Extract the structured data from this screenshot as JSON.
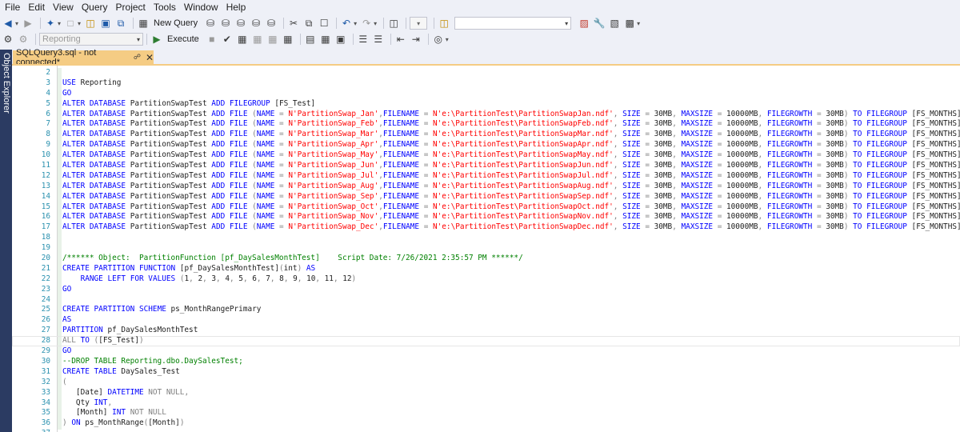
{
  "menu": [
    "File",
    "Edit",
    "View",
    "Query",
    "Project",
    "Tools",
    "Window",
    "Help"
  ],
  "toolbar1": {
    "new_query_label": "New Query",
    "search_value": ""
  },
  "toolbar2": {
    "database_value": "Reporting",
    "execute_label": "Execute"
  },
  "side_panel": {
    "label": "Object Explorer"
  },
  "tab": {
    "title": "SQLQuery3.sql - not connected*"
  },
  "colors": {
    "keyword": "#0000ff",
    "string": "#ff0000",
    "comment": "#008000",
    "operator": "#808080",
    "function": "#ff00ff",
    "line_number": "#2b91af",
    "active_tab": "#f5cc84"
  },
  "editor": {
    "lines": [
      {
        "n": "2",
        "text": ""
      },
      {
        "n": "3",
        "text": "USE Reporting"
      },
      {
        "n": "4",
        "text": "GO"
      },
      {
        "n": "5",
        "text": "ALTER DATABASE PartitionSwapTest ADD FILEGROUP [FS_Test]"
      },
      {
        "n": "6",
        "text": "ALTER DATABASE PartitionSwapTest ADD FILE (NAME = N'PartitionSwap_Jan',FILENAME = N'e:\\PartitionTest\\PartitionSwapJan.ndf', SIZE = 30MB, MAXSIZE = 10000MB, FILEGROWTH = 30MB) TO FILEGROUP [FS_MONTHS]"
      },
      {
        "n": "7",
        "text": "ALTER DATABASE PartitionSwapTest ADD FILE (NAME = N'PartitionSwap_Feb',FILENAME = N'e:\\PartitionTest\\PartitionSwapFeb.ndf', SIZE = 30MB, MAXSIZE = 10000MB, FILEGROWTH = 30MB) TO FILEGROUP [FS_MONTHS]"
      },
      {
        "n": "8",
        "text": "ALTER DATABASE PartitionSwapTest ADD FILE (NAME = N'PartitionSwap_Mar',FILENAME = N'e:\\PartitionTest\\PartitionSwapMar.ndf', SIZE = 30MB, MAXSIZE = 10000MB, FILEGROWTH = 30MB) TO FILEGROUP [FS_MONTHS]"
      },
      {
        "n": "9",
        "text": "ALTER DATABASE PartitionSwapTest ADD FILE (NAME = N'PartitionSwap_Apr',FILENAME = N'e:\\PartitionTest\\PartitionSwapApr.ndf', SIZE = 30MB, MAXSIZE = 10000MB, FILEGROWTH = 30MB) TO FILEGROUP [FS_MONTHS]"
      },
      {
        "n": "10",
        "text": "ALTER DATABASE PartitionSwapTest ADD FILE (NAME = N'PartitionSwap_May',FILENAME = N'e:\\PartitionTest\\PartitionSwapMay.ndf', SIZE = 30MB, MAXSIZE = 10000MB, FILEGROWTH = 30MB) TO FILEGROUP [FS_MONTHS]"
      },
      {
        "n": "11",
        "text": "ALTER DATABASE PartitionSwapTest ADD FILE (NAME = N'PartitionSwap_Jun',FILENAME = N'e:\\PartitionTest\\PartitionSwapJun.ndf', SIZE = 30MB, MAXSIZE = 10000MB, FILEGROWTH = 30MB) TO FILEGROUP [FS_MONTHS]"
      },
      {
        "n": "12",
        "text": "ALTER DATABASE PartitionSwapTest ADD FILE (NAME = N'PartitionSwap_Jul',FILENAME = N'e:\\PartitionTest\\PartitionSwapJul.ndf', SIZE = 30MB, MAXSIZE = 10000MB, FILEGROWTH = 30MB) TO FILEGROUP [FS_MONTHS]"
      },
      {
        "n": "13",
        "text": "ALTER DATABASE PartitionSwapTest ADD FILE (NAME = N'PartitionSwap_Aug',FILENAME = N'e:\\PartitionTest\\PartitionSwapAug.ndf', SIZE = 30MB, MAXSIZE = 10000MB, FILEGROWTH = 30MB) TO FILEGROUP [FS_MONTHS]"
      },
      {
        "n": "14",
        "text": "ALTER DATABASE PartitionSwapTest ADD FILE (NAME = N'PartitionSwap_Sep',FILENAME = N'e:\\PartitionTest\\PartitionSwapSep.ndf', SIZE = 30MB, MAXSIZE = 10000MB, FILEGROWTH = 30MB) TO FILEGROUP [FS_MONTHS]"
      },
      {
        "n": "15",
        "text": "ALTER DATABASE PartitionSwapTest ADD FILE (NAME = N'PartitionSwap_Oct',FILENAME = N'e:\\PartitionTest\\PartitionSwapOct.ndf', SIZE = 30MB, MAXSIZE = 10000MB, FILEGROWTH = 30MB) TO FILEGROUP [FS_MONTHS]"
      },
      {
        "n": "16",
        "text": "ALTER DATABASE PartitionSwapTest ADD FILE (NAME = N'PartitionSwap_Nov',FILENAME = N'e:\\PartitionTest\\PartitionSwapNov.ndf', SIZE = 30MB, MAXSIZE = 10000MB, FILEGROWTH = 30MB) TO FILEGROUP [FS_MONTHS]"
      },
      {
        "n": "17",
        "text": "ALTER DATABASE PartitionSwapTest ADD FILE (NAME = N'PartitionSwap_Dec',FILENAME = N'e:\\PartitionTest\\PartitionSwapDec.ndf', SIZE = 30MB, MAXSIZE = 10000MB, FILEGROWTH = 30MB) TO FILEGROUP [FS_MONTHS]"
      },
      {
        "n": "18",
        "text": ""
      },
      {
        "n": "19",
        "text": ""
      },
      {
        "n": "20",
        "text": "/****** Object:  PartitionFunction [pf_DaySalesMonthTest]    Script Date: 7/26/2021 2:35:57 PM ******/"
      },
      {
        "n": "21",
        "text": "CREATE PARTITION FUNCTION [pf_DaySalesMonthTest](int) AS"
      },
      {
        "n": "22",
        "text": "    RANGE LEFT FOR VALUES (1, 2, 3, 4, 5, 6, 7, 8, 9, 10, 11, 12)"
      },
      {
        "n": "23",
        "text": "GO"
      },
      {
        "n": "24",
        "text": ""
      },
      {
        "n": "25",
        "text": "CREATE PARTITION SCHEME ps_MonthRangePrimary"
      },
      {
        "n": "26",
        "text": "AS"
      },
      {
        "n": "27",
        "text": "PARTITION pf_DaySalesMonthTest"
      },
      {
        "n": "28",
        "text": "ALL TO ([FS_Test])"
      },
      {
        "n": "29",
        "text": "GO"
      },
      {
        "n": "30",
        "text": "--DROP TABLE Reporting.dbo.DaySalesTest;"
      },
      {
        "n": "31",
        "text": "CREATE TABLE DaySales_Test"
      },
      {
        "n": "32",
        "text": "("
      },
      {
        "n": "33",
        "text": "   [Date] DATETIME NOT NULL,"
      },
      {
        "n": "34",
        "text": "   Qty INT,"
      },
      {
        "n": "35",
        "text": "   [Month] INT NOT NULL"
      },
      {
        "n": "36",
        "text": ") ON ps_MonthRange([Month])"
      },
      {
        "n": "37",
        "text": ""
      }
    ]
  }
}
